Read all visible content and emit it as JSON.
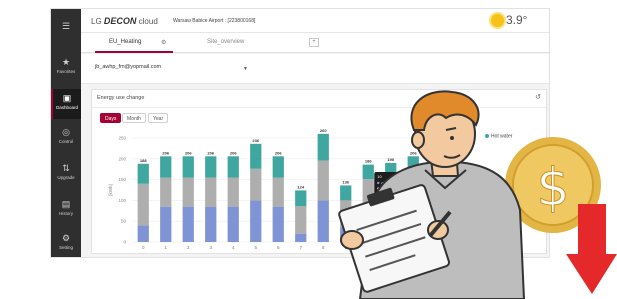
{
  "header": {
    "brand_prefix": "LG",
    "brand_name": "DECON",
    "brand_suffix": "cloud",
    "site_name": "Warsaw Babice Airport : [223800168]",
    "temperature": "3.9°"
  },
  "sidebar": {
    "items": [
      {
        "icon": "☰",
        "label": ""
      },
      {
        "icon": "★",
        "label": "Favorites"
      },
      {
        "icon": "▣",
        "label": "Dashboard"
      },
      {
        "icon": "◎",
        "label": "Control"
      },
      {
        "icon": "⇅",
        "label": "Upgrade"
      },
      {
        "icon": "▤",
        "label": "History"
      },
      {
        "icon": "⚙",
        "label": "Setting"
      }
    ]
  },
  "tabs": {
    "items": [
      "EU_Heating",
      "Site_overview"
    ],
    "add_label": "+"
  },
  "filter": {
    "account": "jb_awhp_fm@yopmail.com"
  },
  "panel": {
    "title": "Energy use change",
    "ranges": [
      "Days",
      "Month",
      "Year"
    ],
    "active_range": "Days"
  },
  "chart_data": {
    "type": "bar",
    "stacked": true,
    "ylabel": "[kWh]",
    "ylim": [
      0,
      250
    ],
    "yticks": [
      0,
      50,
      100,
      150,
      200,
      250
    ],
    "categories": [
      "0",
      "1",
      "2",
      "3",
      "4",
      "5",
      "6",
      "7",
      "8",
      "9",
      "10",
      "11",
      "12",
      "13"
    ],
    "totals": [
      188,
      206,
      206,
      206,
      206,
      236,
      206,
      124,
      260,
      136,
      186,
      190,
      206,
      212
    ],
    "series": [
      {
        "name": "COOL",
        "color": "#7f94d4",
        "values": [
          40,
          85,
          85,
          85,
          85,
          100,
          85,
          20,
          100,
          35,
          65,
          70,
          80,
          80
        ]
      },
      {
        "name": "HEAT",
        "color": "#aeaeae",
        "values": [
          100,
          70,
          70,
          70,
          70,
          76,
          70,
          66,
          96,
          65,
          86,
          76,
          80,
          82
        ]
      },
      {
        "name": "Hot water",
        "color": "#3fa7a0",
        "values": [
          48,
          51,
          51,
          51,
          51,
          60,
          51,
          38,
          64,
          36,
          35,
          44,
          46,
          50
        ]
      }
    ],
    "legend": [
      "Hot water"
    ],
    "tooltip": {
      "title": "10",
      "lines": [
        "COOL : 64",
        "HEAT : 29",
        "Hot water : 36"
      ]
    }
  }
}
